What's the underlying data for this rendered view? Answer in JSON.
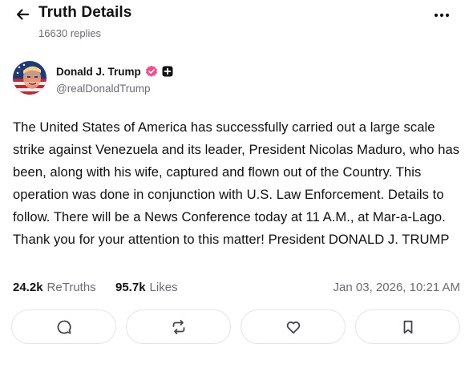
{
  "header": {
    "title": "Truth Details",
    "replies": "16630 replies",
    "back_icon": "arrow-left-icon",
    "more_icon": "more-dots-icon"
  },
  "author": {
    "name": "Donald J. Trump",
    "handle": "@realDonaldTrump",
    "verified_color": "#f7498c",
    "plus_badge_color": "#111111"
  },
  "post": {
    "text": "The United States of America has successfully carried out a large scale strike against Venezuela and its leader, President Nicolas Maduro, who has been, along with his wife, captured and flown out of the Country. This operation was done in conjunction with U.S. Law Enforcement. Details to follow. There will be a News Conference today at 11 A.M., at Mar-a-Lago. Thank you for your attention to this matter! President DONALD J. TRUMP"
  },
  "stats": {
    "retruths_count": "24.2k",
    "retruths_label": "ReTruths",
    "likes_count": "95.7k",
    "likes_label": "Likes",
    "timestamp": "Jan 03, 2026, 10:21 AM"
  },
  "actions": [
    {
      "icon": "reply-bubble-icon"
    },
    {
      "icon": "retruth-icon"
    },
    {
      "icon": "heart-icon"
    },
    {
      "icon": "bookmark-icon"
    }
  ],
  "colors": {
    "text": "#111111",
    "muted": "#6b6b76",
    "border": "#e4e4ea"
  }
}
